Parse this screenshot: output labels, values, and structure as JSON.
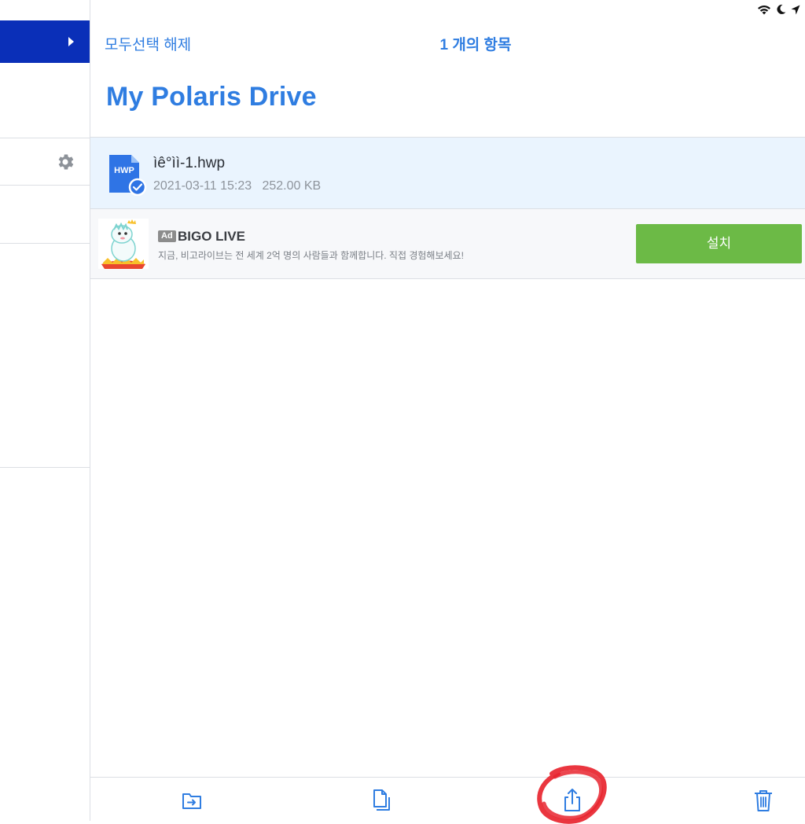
{
  "header": {
    "deselect_all_label": "모두선택 해제",
    "item_count_label": "1 개의 항목",
    "page_title": "My Polaris Drive"
  },
  "file_list": [
    {
      "type_badge": "HWP",
      "name": "ìê°ìì-1.hwp",
      "meta": "2021-03-11 15:23   252.00 KB",
      "selected": true
    }
  ],
  "ad": {
    "badge": "Ad",
    "title": "BIGO LIVE",
    "description": "지금, 비고라이브는 전 세계 2억 명의 사람들과 함께합니다. 직접 경험해보세요!",
    "cta_label": "설치"
  },
  "toolbar": {
    "icons": [
      "move-to-folder-icon",
      "copy-icon",
      "share-icon",
      "trash-icon"
    ]
  },
  "status_bar": {
    "icons": [
      "wifi-icon",
      "moon-icon",
      "location-arrow-icon"
    ]
  },
  "colors": {
    "accent": "#2f7de1",
    "sidebar_active": "#0a2fb8",
    "selected_row": "#eaf4fe",
    "install_button": "#6cba46",
    "annotation_red": "#e8252f"
  }
}
